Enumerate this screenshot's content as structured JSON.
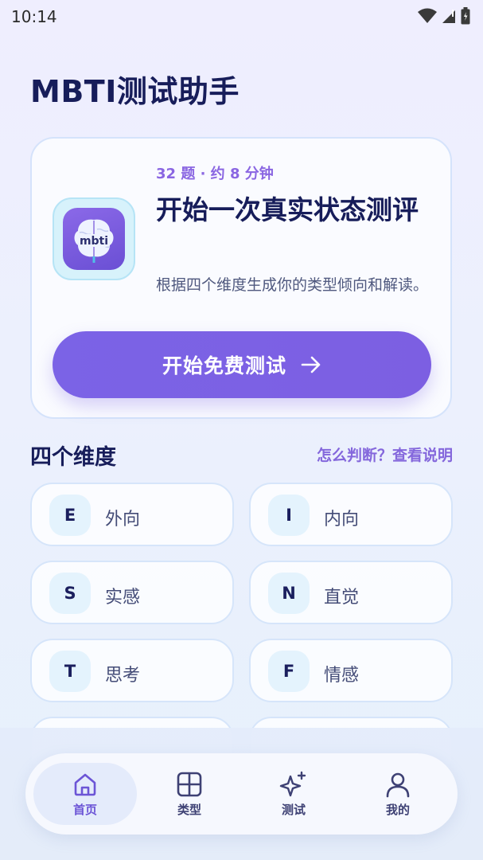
{
  "status": {
    "time": "10:14"
  },
  "app": {
    "title": "MBTI测试助手"
  },
  "hero": {
    "meta": "32 题 · 约 8 分钟",
    "title": "开始一次真实状态测评",
    "description": "根据四个维度生成你的类型倾向和解读。",
    "logo_text": "mbti",
    "button_label": "开始免费测试"
  },
  "dimensions": {
    "title": "四个维度",
    "link": "怎么判断？查看说明",
    "items": [
      {
        "letter": "E",
        "label": "外向"
      },
      {
        "letter": "I",
        "label": "内向"
      },
      {
        "letter": "S",
        "label": "实感"
      },
      {
        "letter": "N",
        "label": "直觉"
      },
      {
        "letter": "T",
        "label": "思考"
      },
      {
        "letter": "F",
        "label": "情感"
      }
    ]
  },
  "nav": {
    "items": [
      {
        "label": "首页",
        "icon": "home-icon",
        "active": true
      },
      {
        "label": "类型",
        "icon": "grid-icon",
        "active": false
      },
      {
        "label": "测试",
        "icon": "sparkle-icon",
        "active": false
      },
      {
        "label": "我的",
        "icon": "user-icon",
        "active": false
      }
    ]
  },
  "colors": {
    "accent": "#7b63e6",
    "title": "#171d5a",
    "meta": "#8a66e2"
  }
}
